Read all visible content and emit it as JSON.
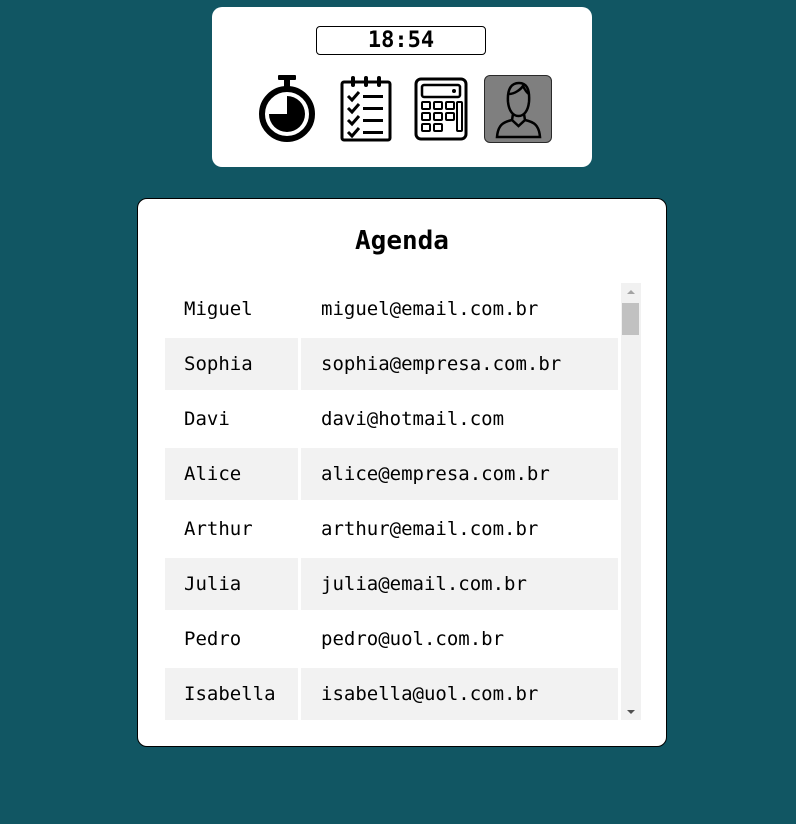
{
  "clock": {
    "time": "18:54"
  },
  "apps": [
    {
      "name": "stopwatch",
      "icon": "stopwatch-icon",
      "active": false
    },
    {
      "name": "tasks",
      "icon": "checklist-icon",
      "active": false
    },
    {
      "name": "calculator",
      "icon": "calculator-icon",
      "active": false
    },
    {
      "name": "contacts",
      "icon": "user-icon",
      "active": true
    }
  ],
  "agenda": {
    "title": "Agenda",
    "contacts": [
      {
        "name": "Miguel",
        "email": "miguel@email.com.br"
      },
      {
        "name": "Sophia",
        "email": "sophia@empresa.com.br"
      },
      {
        "name": "Davi",
        "email": "davi@hotmail.com"
      },
      {
        "name": "Alice",
        "email": "alice@empresa.com.br"
      },
      {
        "name": "Arthur",
        "email": "arthur@email.com.br"
      },
      {
        "name": "Julia",
        "email": "julia@email.com.br"
      },
      {
        "name": "Pedro",
        "email": "pedro@uol.com.br"
      },
      {
        "name": "Isabella",
        "email": "isabella@uol.com.br"
      }
    ]
  },
  "colors": {
    "background": "#115663",
    "row_alt": "#f2f2f2",
    "active_app": "#7f7f7f"
  }
}
